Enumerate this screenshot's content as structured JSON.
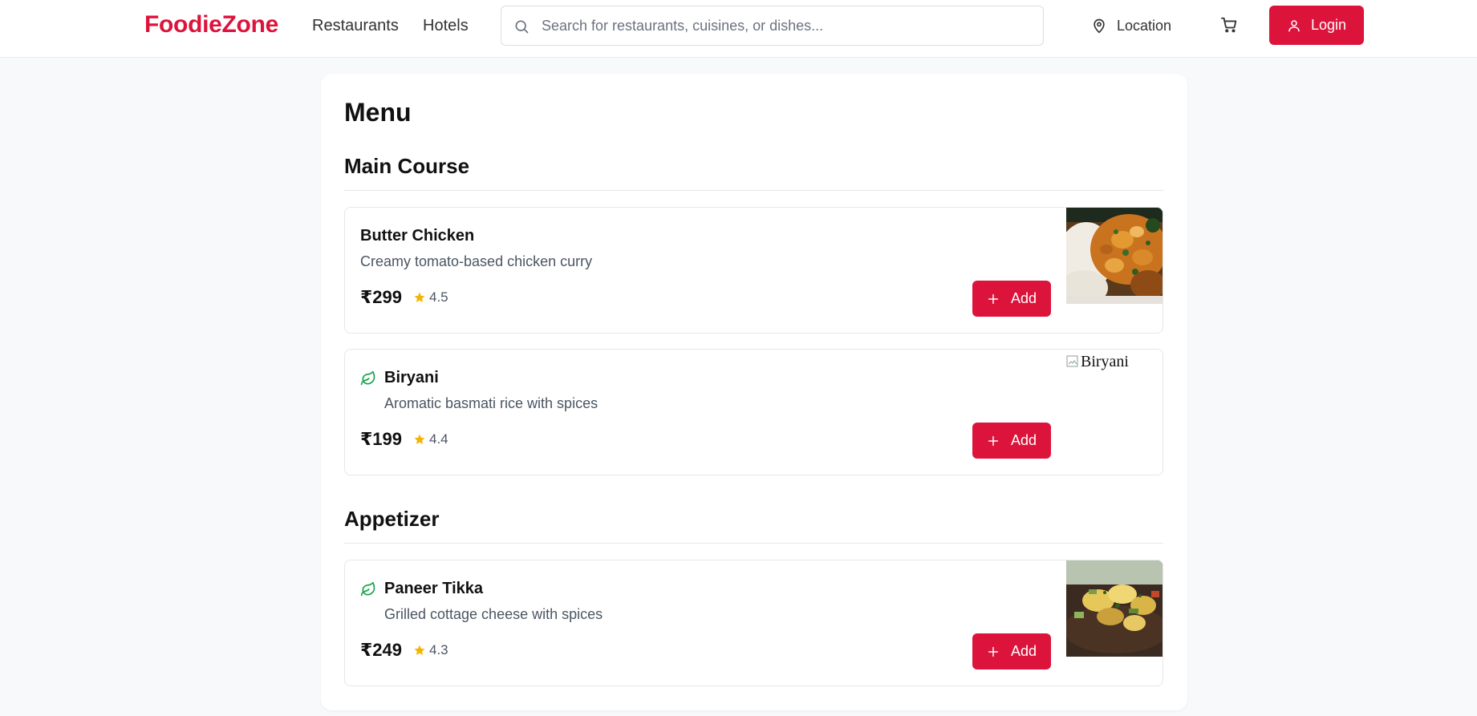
{
  "header": {
    "brand": "FoodieZone",
    "nav": [
      {
        "label": "Restaurants"
      },
      {
        "label": "Hotels"
      }
    ],
    "search_placeholder": "Search for restaurants, cuisines, or dishes...",
    "location_label": "Location",
    "login_label": "Login"
  },
  "menu": {
    "title": "Menu",
    "sections": [
      {
        "title": "Main Course",
        "items": [
          {
            "name": "Butter Chicken",
            "description": "Creamy tomato-based chicken curry",
            "price": "₹299",
            "rating": "4.5",
            "veg": false,
            "add_label": "Add",
            "image": "butter-chicken-photo"
          },
          {
            "name": "Biryani",
            "description": "Aromatic basmati rice with spices",
            "price": "₹199",
            "rating": "4.4",
            "veg": true,
            "add_label": "Add",
            "image_alt": "Biryani"
          }
        ]
      },
      {
        "title": "Appetizer",
        "items": [
          {
            "name": "Paneer Tikka",
            "description": "Grilled cottage cheese with spices",
            "price": "₹249",
            "rating": "4.3",
            "veg": true,
            "add_label": "Add",
            "image": "paneer-tikka-photo"
          }
        ]
      }
    ]
  },
  "colors": {
    "brand": "#dc143c",
    "veg_icon": "#16a34a",
    "star": "#f4b400",
    "background": "#f8f9fa"
  },
  "icons": [
    "search-icon",
    "map-pin-icon",
    "cart-icon",
    "user-icon",
    "leaf-icon",
    "star-icon",
    "plus-icon"
  ]
}
